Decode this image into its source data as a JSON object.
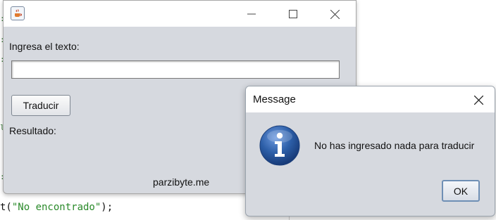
{
  "background_editor": {
    "code_prefix": "t(",
    "code_string": "\"No encontrado\"",
    "code_suffix": ");"
  },
  "main_window": {
    "input_label": "Ingresa el texto:",
    "input_value": "",
    "translate_button": "Traducir",
    "result_label": "Resultado:",
    "footer_text": "parzibyte.me"
  },
  "dialog": {
    "title": "Message",
    "message": "No has ingresado nada para traducir",
    "ok_button": "OK"
  },
  "colors": {
    "window_bg": "#d6d9df",
    "titlebar_bg": "#ffffff",
    "info_icon_blue": "#2d5fa8",
    "code_string_green": "#2a8a2a"
  },
  "icons": {
    "app_icon": "java-cup-icon",
    "info_icon": "info-icon"
  }
}
